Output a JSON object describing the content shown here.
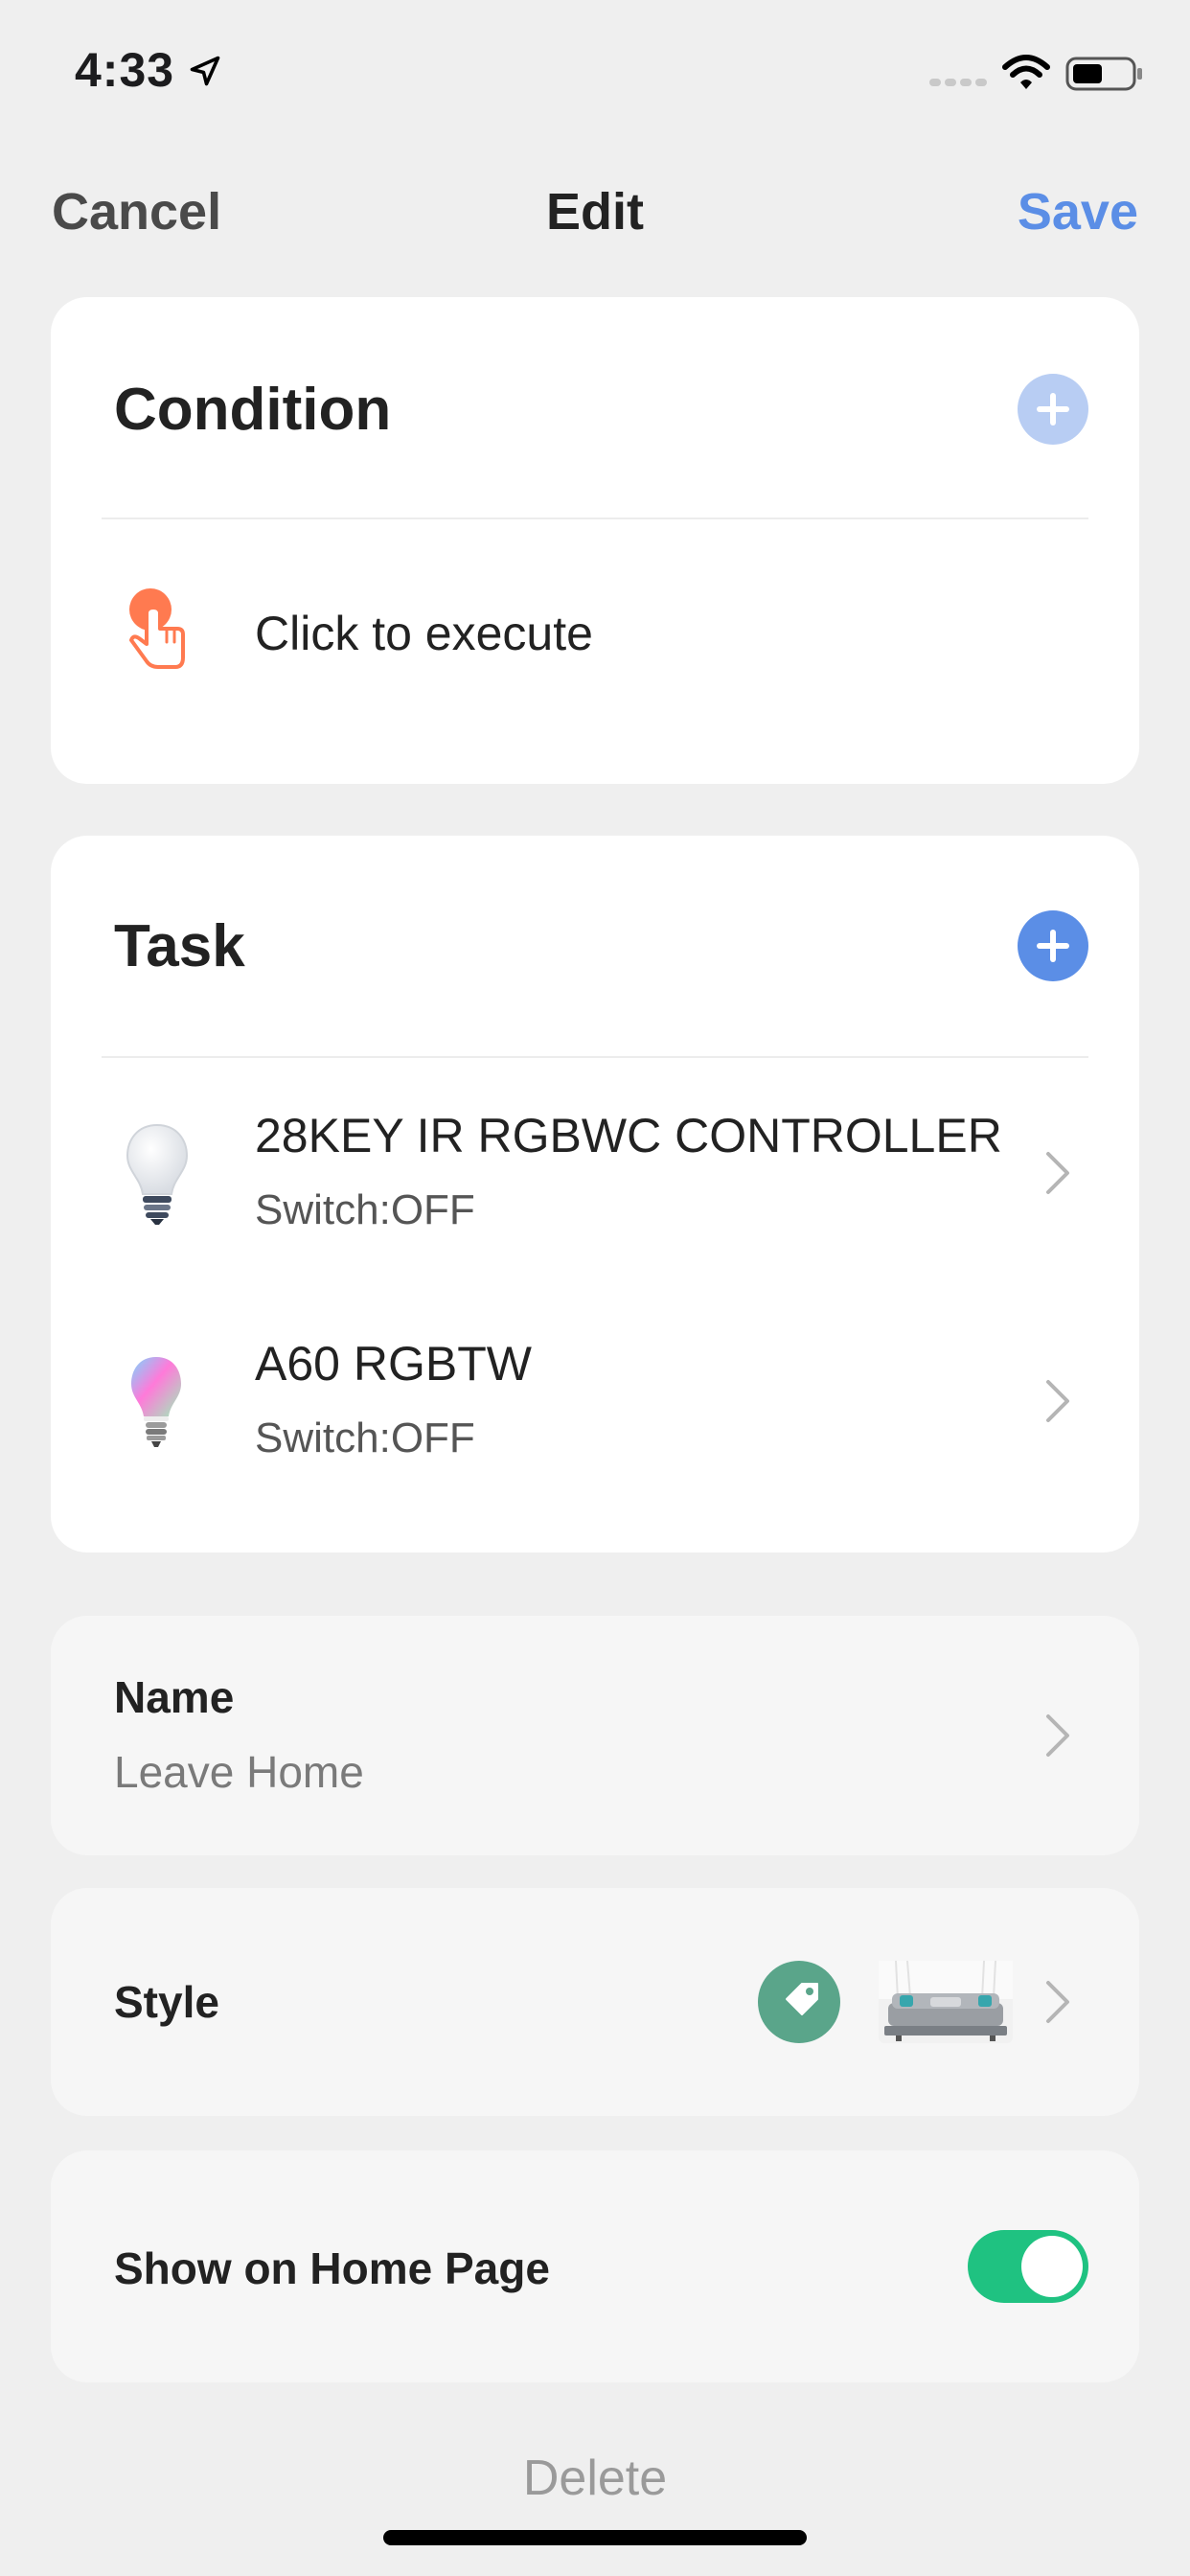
{
  "status_bar": {
    "time": "4:33"
  },
  "nav": {
    "cancel": "Cancel",
    "title": "Edit",
    "save": "Save"
  },
  "condition": {
    "header": "Condition",
    "items": [
      {
        "label": "Click to execute",
        "icon": "hand-tap-icon"
      }
    ]
  },
  "task": {
    "header": "Task",
    "items": [
      {
        "title": "28KEY IR RGBWC CONTROLLER",
        "subtitle": "Switch:OFF",
        "icon": "bulb-white-icon"
      },
      {
        "title": "A60 RGBTW",
        "subtitle": "Switch:OFF",
        "icon": "bulb-color-icon"
      }
    ]
  },
  "name": {
    "label": "Name",
    "value": "Leave Home"
  },
  "style": {
    "label": "Style",
    "tag_color": "#5aa58a"
  },
  "show_home": {
    "label": "Show on Home Page",
    "enabled": true,
    "toggle_color": "#1fc281"
  },
  "delete_label": "Delete",
  "colors": {
    "accent": "#5b8ee6",
    "accent_disabled": "#b8cdf3",
    "condition_icon": "#ff7a50"
  }
}
